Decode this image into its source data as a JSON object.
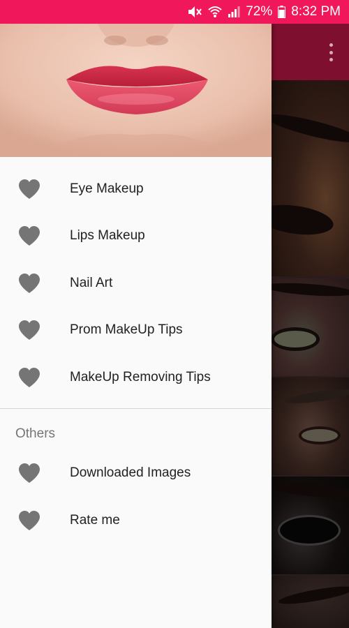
{
  "status_bar": {
    "battery": "72%",
    "time": "8:32 PM",
    "icons": [
      "mute-icon",
      "wifi-icon",
      "signal-icon"
    ]
  },
  "toolbar": {
    "overflow_icon": "more-vert-icon"
  },
  "drawer": {
    "header_image": "lips-photo",
    "main_items": [
      {
        "label": "Eye Makeup",
        "icon": "heart-icon"
      },
      {
        "label": "Lips Makeup",
        "icon": "heart-icon"
      },
      {
        "label": "Nail Art",
        "icon": "heart-icon"
      },
      {
        "label": "Prom MakeUp Tips",
        "icon": "heart-icon"
      },
      {
        "label": "MakeUp Removing Tips",
        "icon": "heart-icon"
      }
    ],
    "section_title": "Others",
    "other_items": [
      {
        "label": "Downloaded Images",
        "icon": "heart-icon"
      },
      {
        "label": "Rate me",
        "icon": "heart-icon"
      }
    ]
  },
  "colors": {
    "status_bar": "#f0185a",
    "toolbar": "#7e0f2f",
    "icon_gray": "#757575",
    "lip_color": "#e53a5c"
  }
}
